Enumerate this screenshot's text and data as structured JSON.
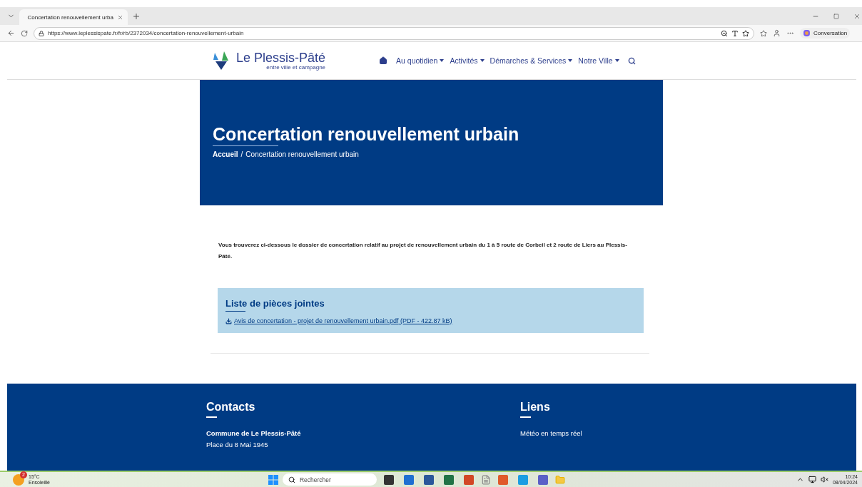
{
  "browser": {
    "tab": {
      "title": "Concertation renouvellement urba",
      "selected": true
    },
    "url": "https://www.leplessispate.fr/fr/rb/2372034/concertation-renouvellement-urbain",
    "copilot": "Conversation"
  },
  "site_header": {
    "logo_name": "Le Plessis-Pâté",
    "logo_tagline": "entre ville et campagne",
    "nav": [
      {
        "label": "Au quotidien",
        "dropdown": true
      },
      {
        "label": "Activités",
        "dropdown": true
      },
      {
        "label": "Démarches & Services",
        "dropdown": true
      },
      {
        "label": "Notre Ville",
        "dropdown": true
      }
    ]
  },
  "hero": {
    "title": "Concertation renouvellement urbain",
    "breadcrumb": [
      {
        "label": "Accueil",
        "current": false
      },
      {
        "label": "Concertation renouvellement urbain",
        "current": true
      }
    ],
    "separator": "/"
  },
  "intro": "Vous trouverez ci-dessous le dossier de concertation relatif au projet de renouvellement urbain du 1 à 5 route de Corbeil et 2 route de Liers au Plessis-Pâté.",
  "attachments": {
    "title": "Liste de pièces jointes",
    "files": [
      {
        "name": "Avis de concertation - projet de renouvellement urbain.pdf",
        "meta": "(PDF - 422.87 kB)"
      }
    ]
  },
  "footer": {
    "columns": [
      {
        "title": "Contacts",
        "lines": [
          {
            "text": "Commune de Le Plessis-Pâté",
            "bold": true
          },
          {
            "text": "Place du 8 Mai 1945",
            "bold": false
          }
        ]
      },
      {
        "title": "Liens",
        "lines": [
          {
            "text": "Météo en temps réel",
            "bold": false
          }
        ]
      }
    ]
  },
  "taskbar": {
    "weather": {
      "badge": "2",
      "temp": "15°C",
      "condition": "Ensoleillé"
    },
    "search_placeholder": "Rechercher",
    "time": "10:24",
    "date": "08/04/2024"
  }
}
